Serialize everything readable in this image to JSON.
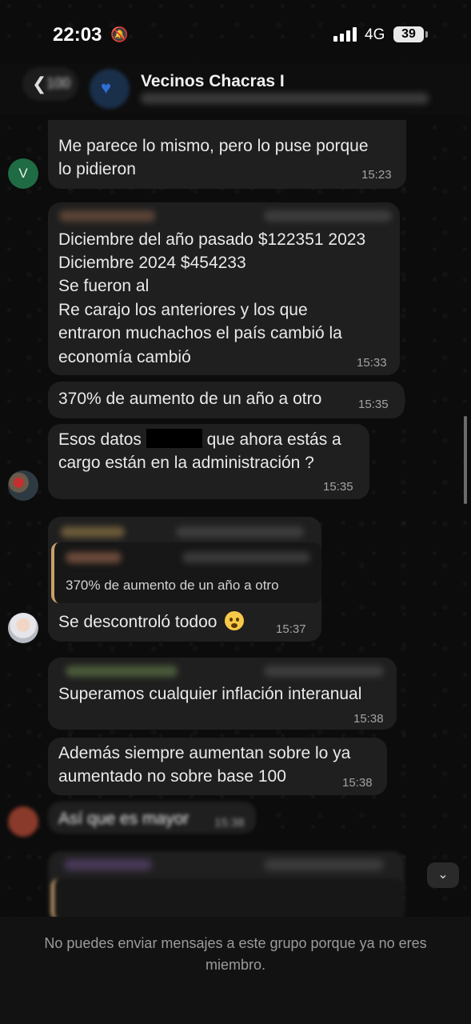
{
  "status_bar": {
    "time": "22:03",
    "network": "4G",
    "battery": "39"
  },
  "header": {
    "back_count": "100",
    "group_name": "Vecinos Chacras I"
  },
  "messages": [
    {
      "initial": "V",
      "lines": [
        "Me parece lo mismo, pero lo puse porque",
        "lo pidieron"
      ],
      "time": "15:23"
    },
    {
      "lines": [
        "Diciembre del año pasado $122351 2023",
        "Diciembre 2024 $454233",
        "Se fueron al",
        "Re carajo los anteriores y los que",
        "entraron muchachos el país cambió la",
        "economía cambió"
      ],
      "time": "15:33"
    },
    {
      "lines": [
        "370% de aumento de un año a otro"
      ],
      "time": "15:35"
    },
    {
      "line1_a": "Esos datos",
      "line1_b": "que ahora estás a",
      "line2": "cargo están en la administración ?",
      "time": "15:35"
    },
    {
      "quote": "370% de aumento de un año a otro",
      "text": "Se descontroló todoo",
      "time": "15:37"
    },
    {
      "lines": [
        "Superamos cualquier inflación interanual"
      ],
      "time": "15:38"
    },
    {
      "lines": [
        "Además siempre aumentan sobre lo ya",
        "aumentado no sobre base 100"
      ],
      "time": "15:38"
    },
    {
      "lines": [
        "Así que es mayor"
      ],
      "time": "15:38"
    }
  ],
  "footer": {
    "notice": "No puedes enviar mensajes a este grupo porque ya no eres miembro."
  },
  "colors": {
    "bubble": "#1f1f1f",
    "background": "#0b0b0b",
    "quote_accent": "#c9a06a",
    "avatar_v": "#1f6b43"
  }
}
